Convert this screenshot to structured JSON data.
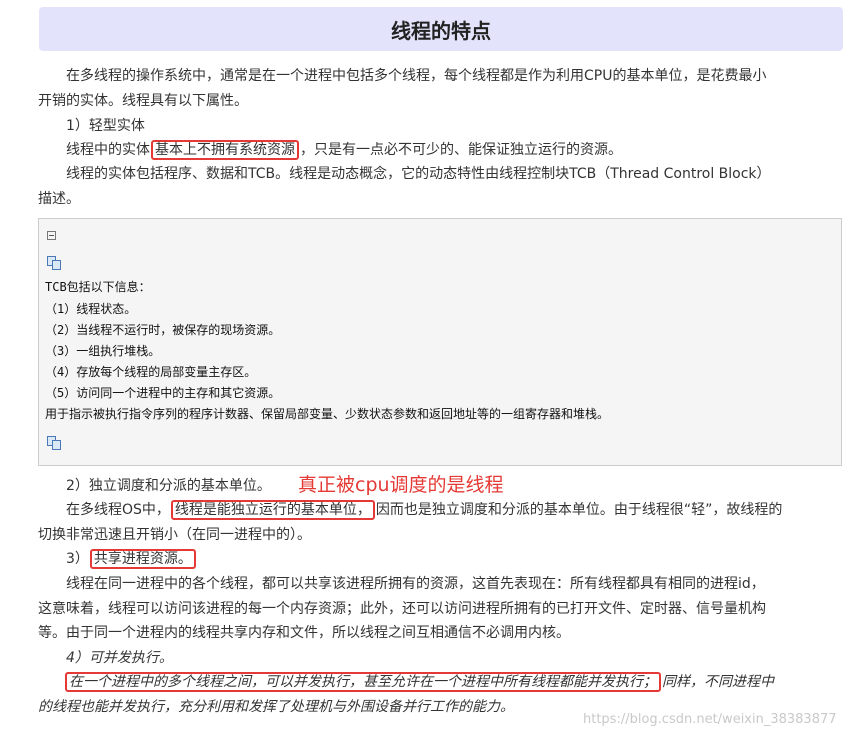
{
  "title": "线程的特点",
  "intro": {
    "line1": "在多线程的操作系统中，通常是在一个进程中包括多个线程，每个线程都是作为利用CPU的基本单位，是花费最小",
    "line2": "开销的实体。线程具有以下属性。"
  },
  "p1": {
    "heading": "1）轻型实体",
    "line_a_pre": "线程中的实体",
    "line_a_hl": "基本上不拥有系统资源",
    "line_a_post": "，只是有一点必不可少的、能保证独立运行的资源。",
    "line_b": "线程的实体包括程序、数据和TCB。线程是动态概念，它的动态特性由线程控制块TCB（Thread Control Block）",
    "line_c": "描述。"
  },
  "code_box": {
    "lines": [
      "TCB包括以下信息：",
      "（1）线程状态。",
      "（2）当线程不运行时，被保存的现场资源。",
      "（3）一组执行堆栈。",
      "（4）存放每个线程的局部变量主存区。",
      "（5）访问同一个进程中的主存和其它资源。",
      "用于指示被执行指令序列的程序计数器、保留局部变量、少数状态参数和返回地址等的一组寄存器和堆栈。"
    ]
  },
  "p2": {
    "heading": "2）独立调度和分派的基本单位。",
    "note": "真正被cpu调度的是线程",
    "line_a_pre": "在多线程OS中，",
    "line_a_hl": "线程是能独立运行的基本单位，",
    "line_a_post": "因而也是独立调度和分派的基本单位。由于线程很“轻”，故线程的",
    "line_b": "切换非常迅速且开销小（在同一进程中的）。"
  },
  "p3": {
    "heading_pre": "3）",
    "heading_hl": "共享进程资源。",
    "line_a": "线程在同一进程中的各个线程，都可以共享该进程所拥有的资源，这首先表现在：所有线程都具有相同的进程id，",
    "line_b": "这意味着，线程可以访问该进程的每一个内存资源；此外，还可以访问进程所拥有的已打开文件、定时器、信号量机构",
    "line_c": "等。由于同一个进程内的线程共享内存和文件，所以线程之间互相通信不必调用内核。"
  },
  "p4": {
    "heading": "4）可并发执行。",
    "line_a_hl": "在一个进程中的多个线程之间，可以并发执行，甚至允许在一个进程中所有线程都能并发执行；",
    "line_a_post": "同样，不同进程中",
    "line_b": "的线程也能并发执行，充分利用和发挥了处理机与外围设备并行工作的能力。"
  },
  "watermark": "https://blog.csdn.net/weixin_38383877",
  "colors": {
    "title_bg": "#e3e4fb",
    "highlight": "#e53935",
    "code_bg": "#f5f5f5"
  }
}
